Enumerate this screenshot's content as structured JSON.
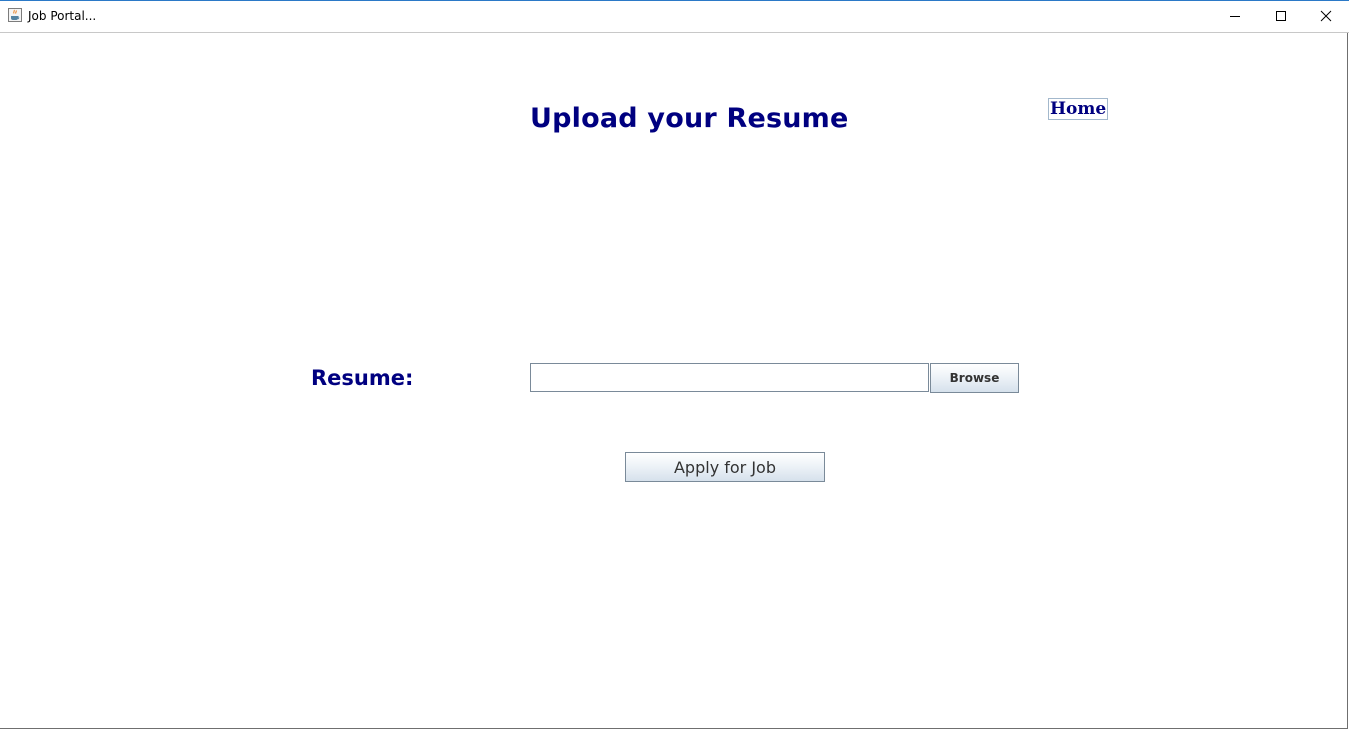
{
  "window": {
    "title": "Job Portal...",
    "icon": "java-cup-icon",
    "controls": [
      "minimize",
      "maximize",
      "close"
    ]
  },
  "page": {
    "title": "Upload your Resume",
    "home_link": "Home"
  },
  "form": {
    "resume_label": "Resume:",
    "resume_value": "",
    "browse_label": "Browse",
    "apply_label": "Apply for Job"
  },
  "colors": {
    "heading": "#000080",
    "button_border": "#7a8a99",
    "window_accent": "#2b79c7"
  }
}
